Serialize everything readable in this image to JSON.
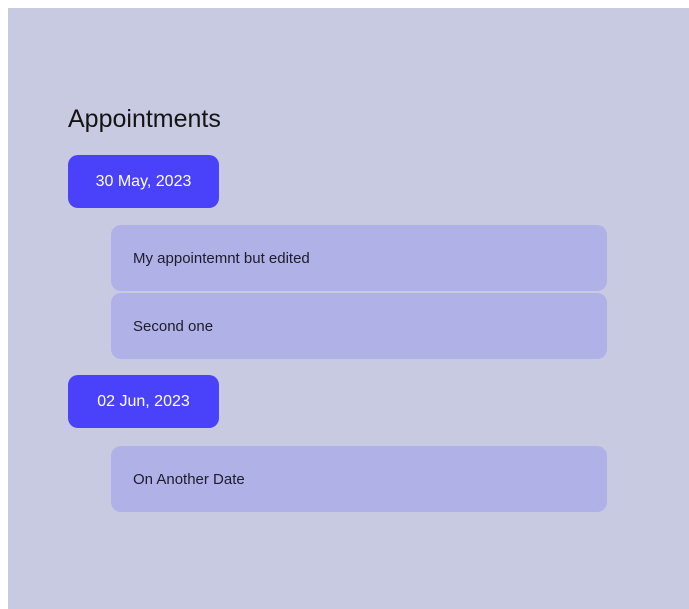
{
  "page": {
    "title": "Appointments"
  },
  "groups": [
    {
      "date": "30 May, 2023",
      "appointments": [
        {
          "title": "My appointemnt but edited"
        },
        {
          "title": "Second one"
        }
      ]
    },
    {
      "date": "02 Jun, 2023",
      "appointments": [
        {
          "title": "On Another Date"
        }
      ]
    }
  ],
  "colors": {
    "background": "#c8cae1",
    "date_chip": "#4a42fb",
    "card": "#b0b1e7",
    "text": "#141414"
  }
}
